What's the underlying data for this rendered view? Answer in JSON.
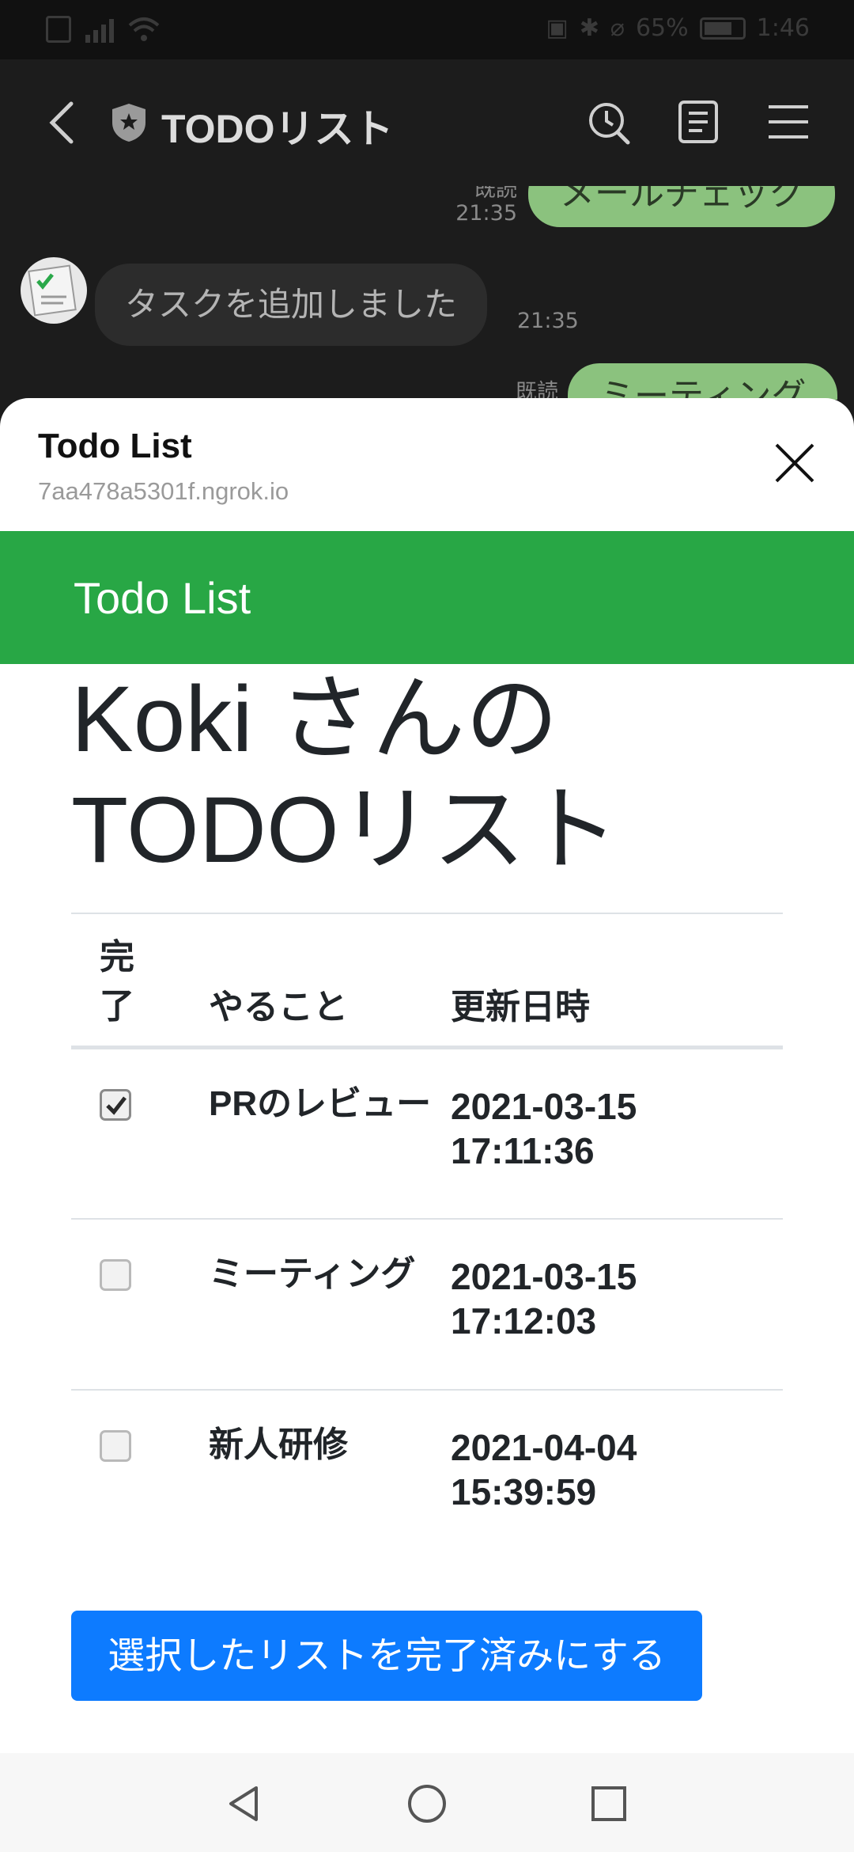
{
  "status_bar": {
    "battery_percent": "65%",
    "time": "1:46"
  },
  "chat_header": {
    "title": "TODOリスト"
  },
  "chat": {
    "messages": [
      {
        "from": "me",
        "text": "メールチェック",
        "read": "既読",
        "time": "21:35"
      },
      {
        "from": "bot",
        "text": "タスクを追加しました",
        "time": "21:35"
      },
      {
        "from": "me",
        "text": "ミーティング",
        "read": "既読"
      }
    ]
  },
  "sheet": {
    "title": "Todo List",
    "url": "7aa478a5301f.ngrok.io"
  },
  "navbar": {
    "brand": "Todo List"
  },
  "page": {
    "title_line1": "Koki さんの",
    "title_line2": "TODOリスト"
  },
  "table": {
    "headers": {
      "done": "完了",
      "task": "やること",
      "updated": "更新日時"
    },
    "rows": [
      {
        "checked": true,
        "task": "PRのレビュー",
        "date": "2021-03-15",
        "time": "17:11:36"
      },
      {
        "checked": false,
        "task": "ミーティング",
        "date": "2021-03-15",
        "time": "17:12:03"
      },
      {
        "checked": false,
        "task": "新人研修",
        "date": "2021-04-04",
        "time": "15:39:59"
      }
    ]
  },
  "actions": {
    "complete_label": "選択したリストを完了済みにする"
  },
  "colors": {
    "navbar": "#28a745",
    "primary_button": "#0d7bff",
    "chat_bubble_me": "#8bc27e"
  }
}
